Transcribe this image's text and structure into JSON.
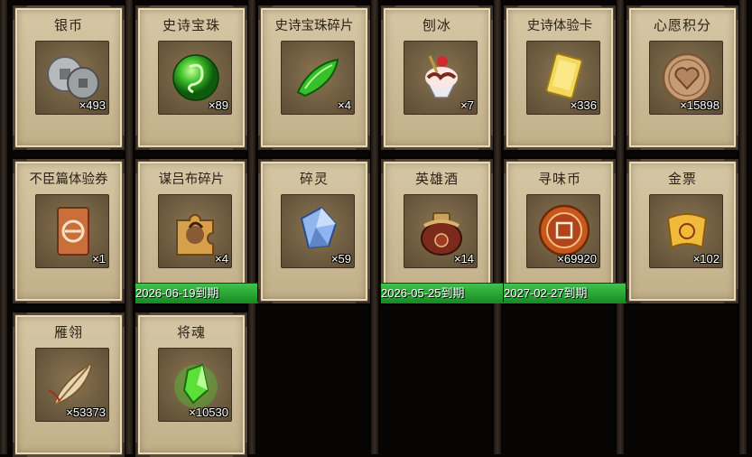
{
  "items": [
    {
      "name": "银币",
      "count": "×493",
      "icon": "silver-coin-icon"
    },
    {
      "name": "史诗宝珠",
      "count": "×89",
      "icon": "green-orb-icon"
    },
    {
      "name": "史诗宝珠碎片",
      "count": "×4",
      "icon": "green-shard-icon"
    },
    {
      "name": "刨冰",
      "count": "×7",
      "icon": "shaved-ice-icon"
    },
    {
      "name": "史诗体验卡",
      "count": "×336",
      "icon": "gold-card-icon"
    },
    {
      "name": "心愿积分",
      "count": "×15898",
      "icon": "heart-coin-icon"
    },
    {
      "name": "不臣篇体验券",
      "count": "×1",
      "icon": "bronze-ticket-icon"
    },
    {
      "name": "谋吕布碎片",
      "count": "×4",
      "icon": "puzzle-piece-icon",
      "expiry": "2026-06-19到期"
    },
    {
      "name": "碎灵",
      "count": "×59",
      "icon": "blue-crystal-icon"
    },
    {
      "name": "英雄酒",
      "count": "×14",
      "icon": "wine-jar-icon",
      "expiry": "2026-05-25到期"
    },
    {
      "name": "寻味币",
      "count": "×69920",
      "icon": "flavor-coin-icon",
      "expiry": "2027-02-27到期"
    },
    {
      "name": "金票",
      "count": "×102",
      "icon": "gold-scroll-icon"
    },
    {
      "name": "雁翎",
      "count": "×53373",
      "icon": "feather-icon"
    },
    {
      "name": "将魂",
      "count": "×10530",
      "icon": "green-soul-crystal-icon"
    }
  ]
}
